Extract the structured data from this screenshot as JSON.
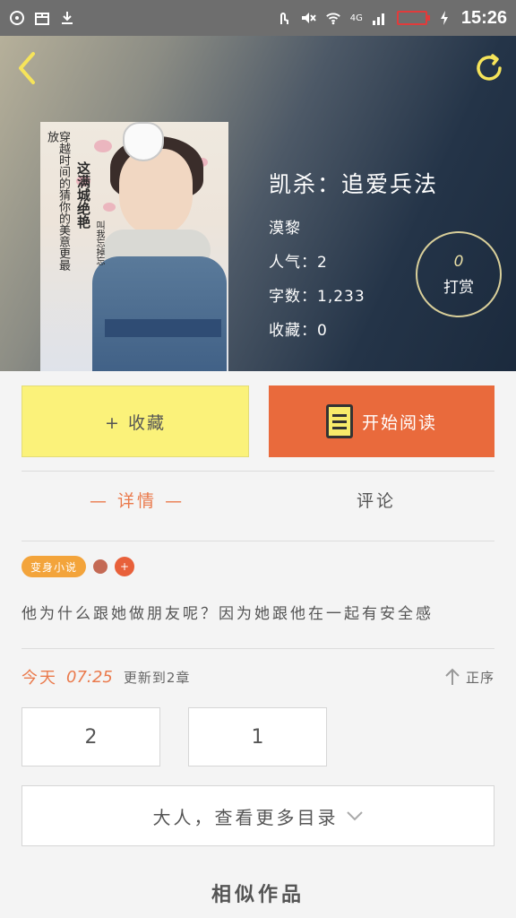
{
  "status_bar": {
    "time": "15:26",
    "network": "4G"
  },
  "book": {
    "title": "凯杀：追爱兵法",
    "author": "漠黎",
    "popularity": "人气：2",
    "word_count": "字数：1,233",
    "favorites": "收藏：0",
    "cover_text": {
      "line1": "穿越时间的猜你的美意更最放",
      "line2": "这满城绝艳",
      "line3": "叫我忘掉忘"
    }
  },
  "tip": {
    "count": "0",
    "label": "打赏"
  },
  "actions": {
    "collect_label": "+ 收藏",
    "read_label": "开始阅读"
  },
  "tabs": {
    "details": "— 详情 —",
    "comments": "评论"
  },
  "tags": {
    "genre": "变身小说",
    "plus": "+"
  },
  "synopsis": "他为什么跟她做朋友呢？因为她跟他在一起有安全感",
  "update": {
    "day": "今天",
    "time": "07:25",
    "text": "更新到2章",
    "sort_label": "正序"
  },
  "chapters": [
    "2",
    "1"
  ],
  "more_catalog": "大人，查看更多目录",
  "similar_title": "相似作品",
  "colors": {
    "accent_orange": "#e96a3c",
    "collect_yellow": "#fbf27a",
    "status_bar": "#6e6e6e"
  }
}
